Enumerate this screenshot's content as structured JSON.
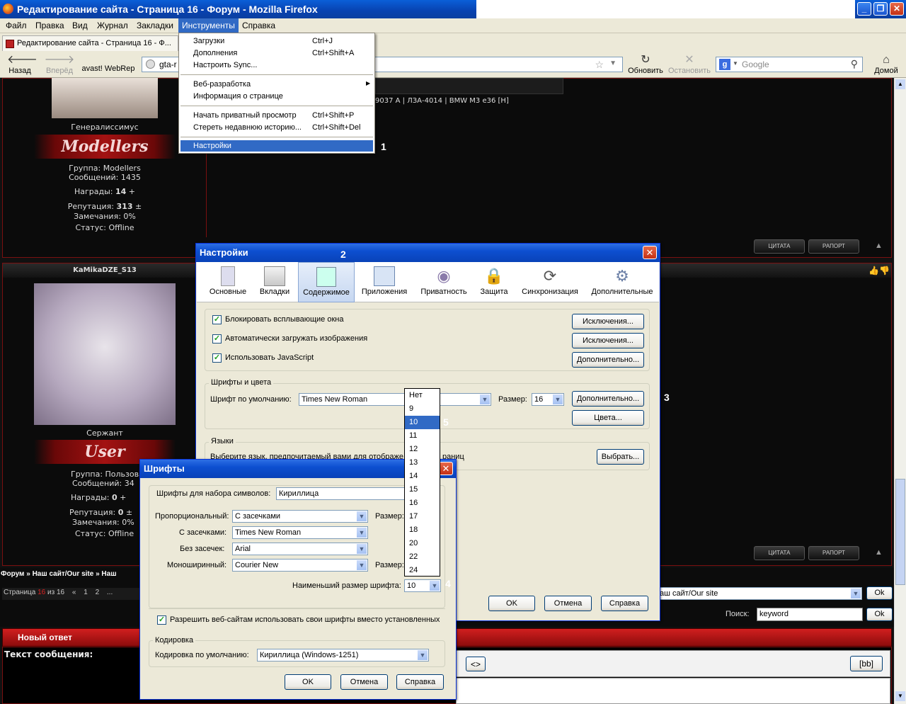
{
  "window": {
    "title": "Редактирование сайта - Страница 16 - Форум - Mozilla Firefox"
  },
  "menubar": {
    "items": [
      "Файл",
      "Правка",
      "Вид",
      "Журнал",
      "Закладки",
      "Инструменты",
      "Справка"
    ]
  },
  "tab": {
    "title": "Редактирование сайта - Страница 16 - Ф..."
  },
  "nav": {
    "back": "Назад",
    "forward": "Вперёд",
    "avast": "avast! WebRep",
    "url": "gta-r",
    "reload": "Обновить",
    "stop": "Остановить",
    "search_placeholder": "Google",
    "home": "Домой"
  },
  "tools_menu": {
    "items": [
      {
        "label": "Загрузки",
        "shortcut": "Ctrl+J"
      },
      {
        "label": "Дополнения",
        "shortcut": "Ctrl+Shift+A"
      },
      {
        "label": "Настроить Sync...",
        "shortcut": ""
      },
      {
        "label": "Веб-разработка",
        "shortcut": ""
      },
      {
        "label": "Информация о странице",
        "shortcut": ""
      },
      {
        "label": "Начать приватный просмотр",
        "shortcut": "Ctrl+Shift+P"
      },
      {
        "label": "Стереть недавнюю историю...",
        "shortcut": "Ctrl+Shift+Del"
      },
      {
        "label": "Настройки",
        "shortcut": ""
      }
    ]
  },
  "markers": {
    "m1": "1",
    "m2": "2",
    "m3": "3",
    "m4": "4",
    "m5": "5"
  },
  "forum": {
    "post1": {
      "car_caption": "9037 A | ЛЗА-4014 | BMW M3 e36 [H]",
      "rank": "Генералиссимус",
      "rank_logo": "Modellers",
      "group": "Группа: Modellers",
      "messages": "Сообщений: 1435",
      "awards_label": "Награды:",
      "awards": "14",
      "awards_plus": "+",
      "rep_label": "Репутация:",
      "rep": "313",
      "rep_pm": "±",
      "warn": "Замечания: 0%",
      "status": "Статус: Offline"
    },
    "post2": {
      "username": "KaMikaDZE_S13",
      "rank": "Сержант",
      "rank_logo": "User",
      "group": "Группа: Пользовате",
      "messages": "Сообщений: 34",
      "awards_label": "Награды:",
      "awards": "0",
      "awards_plus": "+",
      "rep_label": "Репутация:",
      "rep": "0",
      "rep_pm": "±",
      "warn": "Замечания: 0%",
      "status": "Статус: Offline"
    },
    "quote_btn": "ЦИТАТА",
    "report_btn": "РАПОРТ",
    "top_icon": "▲",
    "breadcrumb": "Форум » Наш сайт/Our site » Наш",
    "pages_label": "Страница",
    "page_current": "16",
    "pages_of": "из 16",
    "pager": [
      "«",
      "1",
      "2",
      "..."
    ],
    "jump_select": "аш сайт/Our site",
    "ok": "Ok",
    "search_label": "Поиск:",
    "search_value": "keyword",
    "new_reply": "Новый ответ",
    "message_text": "Текст сообщения:",
    "bb": "[bb]",
    "code": "<>"
  },
  "settings": {
    "title": "Настройки",
    "panes": [
      "Основные",
      "Вкладки",
      "Содержимое",
      "Приложения",
      "Приватность",
      "Защита",
      "Синхронизация",
      "Дополнительные"
    ],
    "block_popups": "Блокировать всплывающие окна",
    "auto_images": "Автоматически загружать изображения",
    "javascript": "Использовать JavaScript",
    "exceptions": "Исключения...",
    "advanced": "Дополнительно...",
    "fonts_group": "Шрифты и цвета",
    "default_font_label": "Шрифт по умолчанию:",
    "default_font": "Times New Roman",
    "size_label": "Размер:",
    "size": "16",
    "colors": "Цвета...",
    "languages_group": "Языки",
    "languages_text": "Выберите язык, предпочитаемый вами для отображе",
    "languages_text_tail": "раниц",
    "choose": "Выбрать...",
    "ok": "OK",
    "cancel": "Отмена",
    "help": "Справка"
  },
  "size_dropdown": {
    "options": [
      "Нет",
      "9",
      "10",
      "11",
      "12",
      "13",
      "14",
      "15",
      "16",
      "17",
      "18",
      "20",
      "22",
      "24"
    ],
    "selected": "10"
  },
  "fonts": {
    "title": "Шрифты",
    "charset_label": "Шрифты для набора символов:",
    "charset": "Кириллица",
    "proportional_label": "Пропорциональный:",
    "proportional": "С засечками",
    "serif_label": "С засечками:",
    "serif": "Times New Roman",
    "sans_label": "Без засечек:",
    "sans": "Arial",
    "mono_label": "Моноширинный:",
    "mono": "Courier New",
    "size_label": "Размер:",
    "min_size_label": "Наименьший размер шрифта:",
    "min_size": "10",
    "allow_fonts": "Разрешить веб-сайтам использовать свои шрифты вместо установленных",
    "encoding_group": "Кодировка",
    "encoding_label": "Кодировка по умолчанию:",
    "encoding": "Кириллица (Windows-1251)",
    "ok": "OK",
    "cancel": "Отмена",
    "help": "Справка"
  }
}
